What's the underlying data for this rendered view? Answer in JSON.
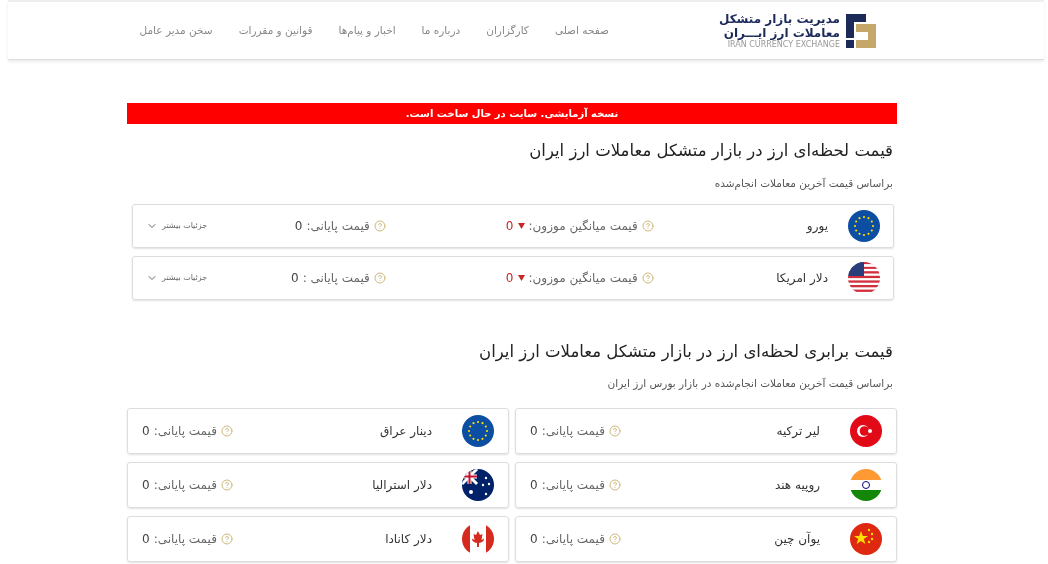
{
  "header": {
    "logo": {
      "title_line_1": "مدیریت بازار متشکل",
      "title_line_2": "معاملات ارز ایـــران",
      "tagline": "IRAN CURRENCY EXCHANGE"
    },
    "nav": [
      {
        "label": "صفحه اصلی"
      },
      {
        "label": "کارگزاران"
      },
      {
        "label": "درباره ما"
      },
      {
        "label": "اخبار و پیام‌ها"
      },
      {
        "label": "قوانین و مقررات"
      },
      {
        "label": "سخن مدیر عامل"
      }
    ]
  },
  "notice": "نسخه آزمایشی. سایت در حال ساخت است.",
  "rates": {
    "title": "قیمت لحظه‌ای ارز در بازار متشکل معاملات ارز ایران",
    "subtitle": "براساس قیمت آخرین معاملات انجام‌شده",
    "rows": [
      {
        "kind": "eu",
        "name": "یورو",
        "avg_label": "قیمت میانگین موزون:",
        "falling": true,
        "avg_value": "0",
        "final_label": "قیمت پایانی:",
        "final_value": "0",
        "details": "جزئیات بیشتر",
        "expanded": false
      },
      {
        "kind": "us",
        "name": "دلار امریکا",
        "avg_label": "قیمت میانگین موزون:",
        "falling": true,
        "avg_value": "0",
        "final_label": "قیمت پایانی :",
        "final_value": "0",
        "details": "جزئیات بیشتر",
        "expanded": false
      }
    ]
  },
  "parity": {
    "title": "قیمت برابری لحظه‌ای ارز در بازار متشکل معاملات ارز ایران",
    "subtitle": "براساس قیمت آخرین معاملات انجام‌شده در بازار بورس ارز ایران",
    "cards": [
      {
        "kind": "tr",
        "name": "لیر ترکیه",
        "final_label": "قیمت پایانی:",
        "final_value": "0"
      },
      {
        "kind": "eu",
        "name": "دینار عراق",
        "final_label": "قیمت پایانی:",
        "final_value": "0"
      },
      {
        "kind": "in",
        "name": "روپیه هند",
        "final_label": "قیمت پایانی:",
        "final_value": "0"
      },
      {
        "kind": "au",
        "name": "دلار استرالیا",
        "final_label": "قیمت پایانی:",
        "final_value": "0"
      },
      {
        "kind": "cn",
        "name": "یوآن چین",
        "final_label": "قیمت پایانی:",
        "final_value": "0"
      },
      {
        "kind": "ca",
        "name": "دلار کانادا",
        "final_label": "قیمت پایانی:",
        "final_value": "0"
      }
    ]
  }
}
